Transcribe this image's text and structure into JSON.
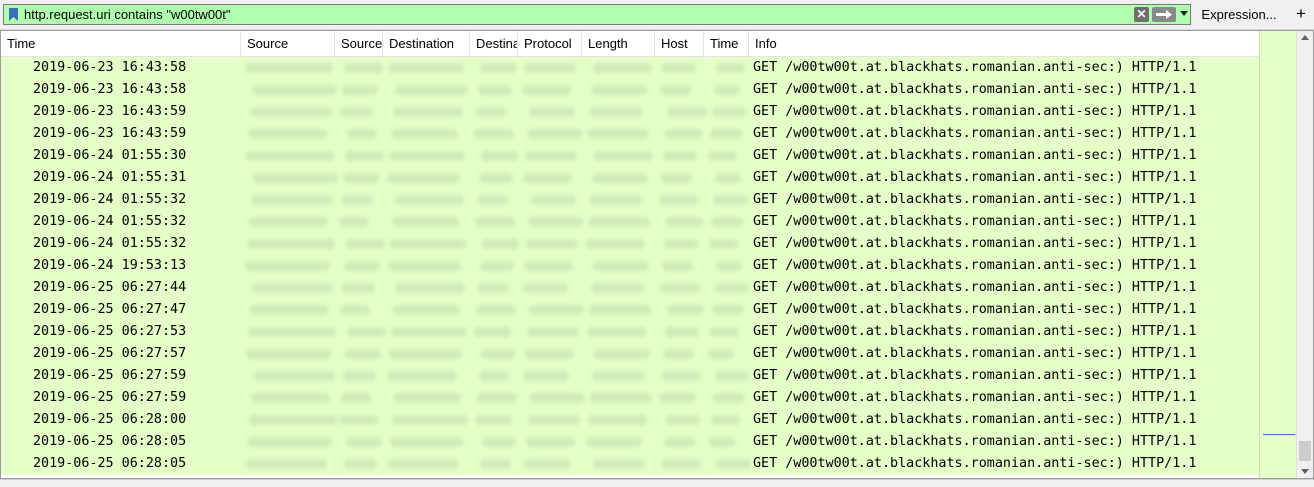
{
  "filter": {
    "value": "http.request.uri contains \"w00tw00t\"",
    "expression_label": "Expression...",
    "add_label": "+",
    "clear_label": "✕"
  },
  "columns": [
    "Time",
    "Source",
    "Source",
    "Destination",
    "Destination",
    "Protocol",
    "Length",
    "Host",
    "Time",
    "Info"
  ],
  "colors": {
    "filter_ok": "#afffaf",
    "row_bg": "#e4ffc7"
  },
  "rows": [
    {
      "time": "2019-06-23 16:43:58",
      "info": "GET /w00tw00t.at.blackhats.romanian.anti-sec:) HTTP/1.1"
    },
    {
      "time": "2019-06-23 16:43:58",
      "info": "GET /w00tw00t.at.blackhats.romanian.anti-sec:) HTTP/1.1"
    },
    {
      "time": "2019-06-23 16:43:59",
      "info": "GET /w00tw00t.at.blackhats.romanian.anti-sec:) HTTP/1.1"
    },
    {
      "time": "2019-06-23 16:43:59",
      "info": "GET /w00tw00t.at.blackhats.romanian.anti-sec:) HTTP/1.1"
    },
    {
      "time": "2019-06-24 01:55:30",
      "info": "GET /w00tw00t.at.blackhats.romanian.anti-sec:) HTTP/1.1"
    },
    {
      "time": "2019-06-24 01:55:31",
      "info": "GET /w00tw00t.at.blackhats.romanian.anti-sec:) HTTP/1.1"
    },
    {
      "time": "2019-06-24 01:55:32",
      "info": "GET /w00tw00t.at.blackhats.romanian.anti-sec:) HTTP/1.1"
    },
    {
      "time": "2019-06-24 01:55:32",
      "info": "GET /w00tw00t.at.blackhats.romanian.anti-sec:) HTTP/1.1"
    },
    {
      "time": "2019-06-24 01:55:32",
      "info": "GET /w00tw00t.at.blackhats.romanian.anti-sec:) HTTP/1.1"
    },
    {
      "time": "2019-06-24 19:53:13",
      "info": "GET /w00tw00t.at.blackhats.romanian.anti-sec:) HTTP/1.1"
    },
    {
      "time": "2019-06-25 06:27:44",
      "info": "GET /w00tw00t.at.blackhats.romanian.anti-sec:) HTTP/1.1"
    },
    {
      "time": "2019-06-25 06:27:47",
      "info": "GET /w00tw00t.at.blackhats.romanian.anti-sec:) HTTP/1.1"
    },
    {
      "time": "2019-06-25 06:27:53",
      "info": "GET /w00tw00t.at.blackhats.romanian.anti-sec:) HTTP/1.1"
    },
    {
      "time": "2019-06-25 06:27:57",
      "info": "GET /w00tw00t.at.blackhats.romanian.anti-sec:) HTTP/1.1"
    },
    {
      "time": "2019-06-25 06:27:59",
      "info": "GET /w00tw00t.at.blackhats.romanian.anti-sec:) HTTP/1.1"
    },
    {
      "time": "2019-06-25 06:27:59",
      "info": "GET /w00tw00t.at.blackhats.romanian.anti-sec:) HTTP/1.1"
    },
    {
      "time": "2019-06-25 06:28:00",
      "info": "GET /w00tw00t.at.blackhats.romanian.anti-sec:) HTTP/1.1"
    },
    {
      "time": "2019-06-25 06:28:05",
      "info": "GET /w00tw00t.at.blackhats.romanian.anti-sec:) HTTP/1.1"
    },
    {
      "time": "2019-06-25 06:28:05",
      "info": "GET /w00tw00t.at.blackhats.romanian.anti-sec:) HTTP/1.1"
    }
  ]
}
